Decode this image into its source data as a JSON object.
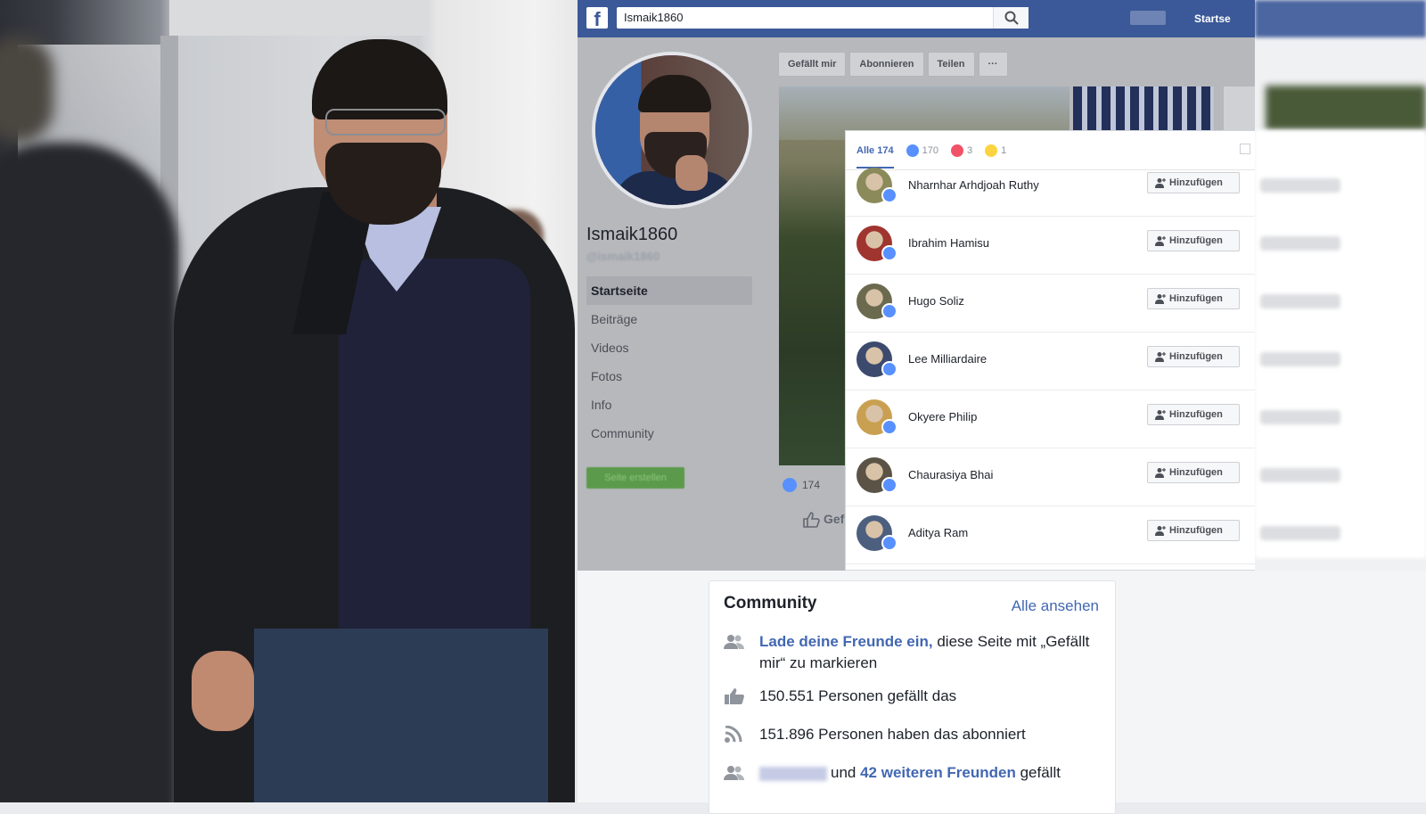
{
  "fb": {
    "search_value": "Ismaik1860",
    "top_link": "Startse",
    "page_name": "Ismaik1860",
    "page_handle": "@ismaik1860",
    "nav": [
      "Startseite",
      "Beiträge",
      "Videos",
      "Fotos",
      "Info",
      "Community"
    ],
    "create_page": "Seite erstellen",
    "actions": [
      "Gefällt mir",
      "Abonnieren",
      "Teilen",
      "···"
    ],
    "reaction_count": "174",
    "like_label": "Gef"
  },
  "modal": {
    "tab_all": "Alle 174",
    "tab_like": "170",
    "tab_love": "3",
    "tab_wow": "1",
    "add_label": "Hinzufügen",
    "people": [
      {
        "name": "Nharnhar Arhdjoah Ruthy",
        "avatar_color": "#8b8a5a"
      },
      {
        "name": "Ibrahim Hamisu",
        "avatar_color": "#a0342e"
      },
      {
        "name": "Hugo Soliz",
        "avatar_color": "#6b6a4f"
      },
      {
        "name": "Lee Milliardaire",
        "avatar_color": "#3c4a6e"
      },
      {
        "name": "Okyere Philip",
        "avatar_color": "#c9a052"
      },
      {
        "name": "Chaurasiya Bhai",
        "avatar_color": "#5a5346"
      },
      {
        "name": "Aditya Ram",
        "avatar_color": "#4d5f7f"
      }
    ]
  },
  "community": {
    "title": "Community",
    "see_all": "Alle ansehen",
    "invite_link": "Lade deine Freunde ein,",
    "invite_rest": " diese Seite mit „Gefällt mir“ zu markieren",
    "likes_text": "150.551 Personen gefällt das",
    "follows_text": "151.896 Personen haben das abonniert",
    "friends_pre": "und ",
    "friends_link": "42 weiteren Freunden",
    "friends_post": " gefällt"
  },
  "colors": {
    "fb_blue": "#3b5998",
    "link_blue": "#4267b2",
    "like_blue": "#5890ff"
  }
}
